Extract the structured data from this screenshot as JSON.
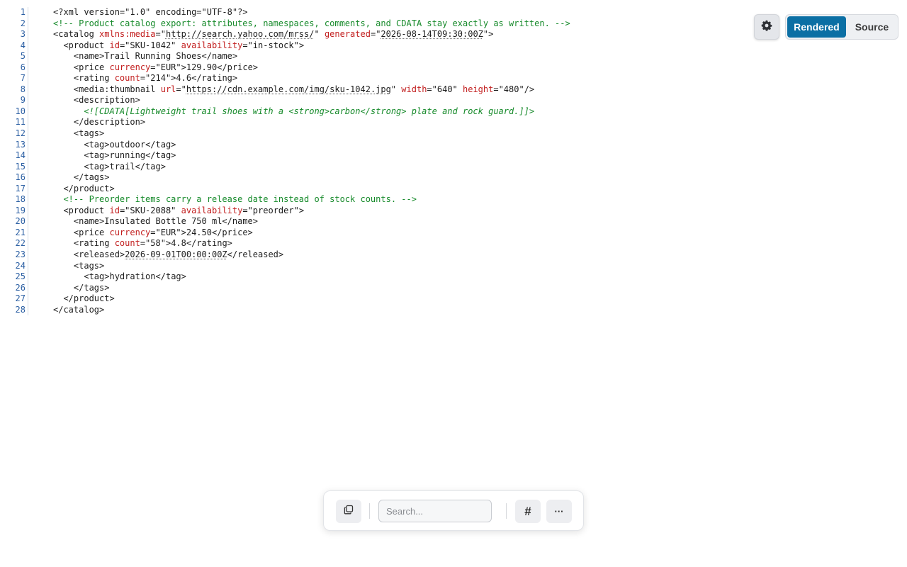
{
  "view_toggle": {
    "rendered_label": "Rendered",
    "source_label": "Source",
    "active": "Rendered"
  },
  "settings": {
    "icon": "gear-icon"
  },
  "toolbar": {
    "copy_icon": "copy-icon",
    "search_placeholder": "Search...",
    "line_numbers_label": "#",
    "more_label": "···"
  },
  "lines": [
    {
      "n": "1",
      "tokens": [
        {
          "t": "<?xml version=\"1.0\" encoding=\"UTF-8\"?>",
          "c": "decl"
        }
      ]
    },
    {
      "n": "2",
      "tokens": [
        {
          "t": "<!-- Product catalog export: attributes, namespaces, comments, and CDATA stay exactly as written. -->",
          "c": "comment"
        }
      ]
    },
    {
      "n": "3",
      "tokens": [
        {
          "t": "<catalog ",
          "c": "tag"
        },
        {
          "t": "xmlns:media",
          "c": "attr"
        },
        {
          "t": "=\"",
          "c": "q"
        },
        {
          "t": "http://search.yahoo.com/mrss/",
          "c": "link"
        },
        {
          "t": "\" ",
          "c": "q"
        },
        {
          "t": "generated",
          "c": "attr"
        },
        {
          "t": "=\"",
          "c": "q"
        },
        {
          "t": "2026-08-14T09:30:00Z",
          "c": "link"
        },
        {
          "t": "\">",
          "c": "q"
        }
      ]
    },
    {
      "n": "4",
      "tokens": [
        {
          "t": "  <product ",
          "c": "tag"
        },
        {
          "t": "id",
          "c": "attr"
        },
        {
          "t": "=\"SKU-1042\" ",
          "c": "val"
        },
        {
          "t": "availability",
          "c": "attr"
        },
        {
          "t": "=\"in-stock\">",
          "c": "val"
        }
      ]
    },
    {
      "n": "5",
      "tokens": [
        {
          "t": "    <name>",
          "c": "tag"
        },
        {
          "t": "Trail Running Shoes",
          "c": "text"
        },
        {
          "t": "</name>",
          "c": "tag"
        }
      ]
    },
    {
      "n": "6",
      "tokens": [
        {
          "t": "    <price ",
          "c": "tag"
        },
        {
          "t": "currency",
          "c": "attr"
        },
        {
          "t": "=\"EUR\">",
          "c": "val"
        },
        {
          "t": "129.90",
          "c": "text"
        },
        {
          "t": "</price>",
          "c": "tag"
        }
      ]
    },
    {
      "n": "7",
      "tokens": [
        {
          "t": "    <rating ",
          "c": "tag"
        },
        {
          "t": "count",
          "c": "attr"
        },
        {
          "t": "=\"214\">",
          "c": "val"
        },
        {
          "t": "4.6",
          "c": "text"
        },
        {
          "t": "</rating>",
          "c": "tag"
        }
      ]
    },
    {
      "n": "8",
      "tokens": [
        {
          "t": "    <media:thumbnail ",
          "c": "tag"
        },
        {
          "t": "url",
          "c": "attr"
        },
        {
          "t": "=\"",
          "c": "q"
        },
        {
          "t": "https://cdn.example.com/img/sku-1042.jpg",
          "c": "link"
        },
        {
          "t": "\" ",
          "c": "q"
        },
        {
          "t": "width",
          "c": "attr"
        },
        {
          "t": "=\"640\" ",
          "c": "val"
        },
        {
          "t": "height",
          "c": "attr"
        },
        {
          "t": "=\"480\"/>",
          "c": "val"
        }
      ]
    },
    {
      "n": "9",
      "tokens": [
        {
          "t": "    <description>",
          "c": "tag"
        }
      ]
    },
    {
      "n": "10",
      "tokens": [
        {
          "t": "      <![CDATA[Lightweight trail shoes with a <strong>carbon</strong> plate and rock guard.]]>",
          "c": "cdata"
        }
      ]
    },
    {
      "n": "11",
      "tokens": [
        {
          "t": "    </description>",
          "c": "tag"
        }
      ]
    },
    {
      "n": "12",
      "tokens": [
        {
          "t": "    <tags>",
          "c": "tag"
        }
      ]
    },
    {
      "n": "13",
      "tokens": [
        {
          "t": "      <tag>",
          "c": "tag"
        },
        {
          "t": "outdoor",
          "c": "text"
        },
        {
          "t": "</tag>",
          "c": "tag"
        }
      ]
    },
    {
      "n": "14",
      "tokens": [
        {
          "t": "      <tag>",
          "c": "tag"
        },
        {
          "t": "running",
          "c": "text"
        },
        {
          "t": "</tag>",
          "c": "tag"
        }
      ]
    },
    {
      "n": "15",
      "tokens": [
        {
          "t": "      <tag>",
          "c": "tag"
        },
        {
          "t": "trail",
          "c": "text"
        },
        {
          "t": "</tag>",
          "c": "tag"
        }
      ]
    },
    {
      "n": "16",
      "tokens": [
        {
          "t": "    </tags>",
          "c": "tag"
        }
      ]
    },
    {
      "n": "17",
      "tokens": [
        {
          "t": "  </product>",
          "c": "tag"
        }
      ]
    },
    {
      "n": "18",
      "tokens": [
        {
          "t": "  <!-- Preorder items carry a release date instead of stock counts. -->",
          "c": "comment"
        }
      ]
    },
    {
      "n": "19",
      "tokens": [
        {
          "t": "  <product ",
          "c": "tag"
        },
        {
          "t": "id",
          "c": "attr"
        },
        {
          "t": "=\"SKU-2088\" ",
          "c": "val"
        },
        {
          "t": "availability",
          "c": "attr"
        },
        {
          "t": "=\"preorder\">",
          "c": "val"
        }
      ]
    },
    {
      "n": "20",
      "tokens": [
        {
          "t": "    <name>",
          "c": "tag"
        },
        {
          "t": "Insulated Bottle 750 ml",
          "c": "text"
        },
        {
          "t": "</name>",
          "c": "tag"
        }
      ]
    },
    {
      "n": "21",
      "tokens": [
        {
          "t": "    <price ",
          "c": "tag"
        },
        {
          "t": "currency",
          "c": "attr"
        },
        {
          "t": "=\"EUR\">",
          "c": "val"
        },
        {
          "t": "24.50",
          "c": "text"
        },
        {
          "t": "</price>",
          "c": "tag"
        }
      ]
    },
    {
      "n": "22",
      "tokens": [
        {
          "t": "    <rating ",
          "c": "tag"
        },
        {
          "t": "count",
          "c": "attr"
        },
        {
          "t": "=\"58\">",
          "c": "val"
        },
        {
          "t": "4.8",
          "c": "text"
        },
        {
          "t": "</rating>",
          "c": "tag"
        }
      ]
    },
    {
      "n": "23",
      "tokens": [
        {
          "t": "    <released>",
          "c": "tag"
        },
        {
          "t": "2026-09-01T00:00:00Z",
          "c": "link"
        },
        {
          "t": "</released>",
          "c": "tag"
        }
      ]
    },
    {
      "n": "24",
      "tokens": [
        {
          "t": "    <tags>",
          "c": "tag"
        }
      ]
    },
    {
      "n": "25",
      "tokens": [
        {
          "t": "      <tag>",
          "c": "tag"
        },
        {
          "t": "hydration",
          "c": "text"
        },
        {
          "t": "</tag>",
          "c": "tag"
        }
      ]
    },
    {
      "n": "26",
      "tokens": [
        {
          "t": "    </tags>",
          "c": "tag"
        }
      ]
    },
    {
      "n": "27",
      "tokens": [
        {
          "t": "  </product>",
          "c": "tag"
        }
      ]
    },
    {
      "n": "28",
      "tokens": [
        {
          "t": "</catalog>",
          "c": "tag"
        }
      ]
    }
  ]
}
